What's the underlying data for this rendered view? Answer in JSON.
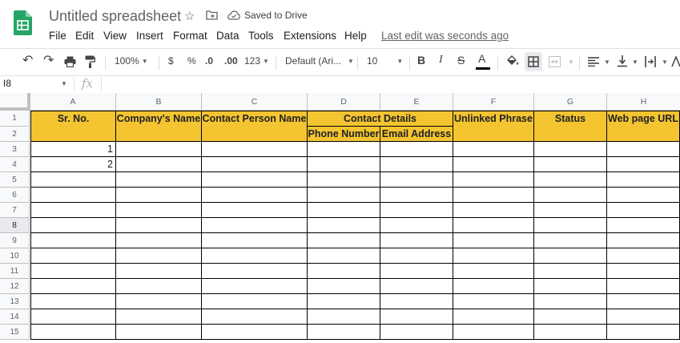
{
  "app": {
    "title": "Untitled spreadsheet",
    "saved_status": "Saved to Drive",
    "last_edit": "Last edit was seconds ago"
  },
  "menu": [
    "File",
    "Edit",
    "View",
    "Insert",
    "Format",
    "Data",
    "Tools",
    "Extensions",
    "Help"
  ],
  "toolbar": {
    "zoom": "100%",
    "currency": "$",
    "percent": "%",
    "decimal_decrease": ".0",
    "decimal_increase": ".00",
    "more_formats": "123",
    "font": "Default (Ari...",
    "font_size": "10",
    "text_color_accent": "#000000"
  },
  "formula_bar": {
    "name_box": "I8",
    "fx_label": "fx",
    "value": ""
  },
  "sheet": {
    "columns": [
      "A",
      "B",
      "C",
      "D",
      "E",
      "F",
      "G",
      "H"
    ],
    "rows": [
      "1",
      "2",
      "3",
      "4",
      "5",
      "6",
      "7",
      "8",
      "9",
      "10",
      "11",
      "12",
      "13",
      "14",
      "15"
    ],
    "headers": {
      "sr_no": "Sr. No.",
      "company_name": "Company's Name",
      "contact_person": "Contact Person Name",
      "contact_details": "Contact Details",
      "phone_number": "Phone Number",
      "email_address": "Email Address",
      "unlinked_phrase": "Unlinked Phrase",
      "status": "Status",
      "web_page_url": "Web page URL"
    },
    "data": {
      "a3": "1",
      "a4": "2"
    },
    "header_fill": "#f4c431"
  }
}
